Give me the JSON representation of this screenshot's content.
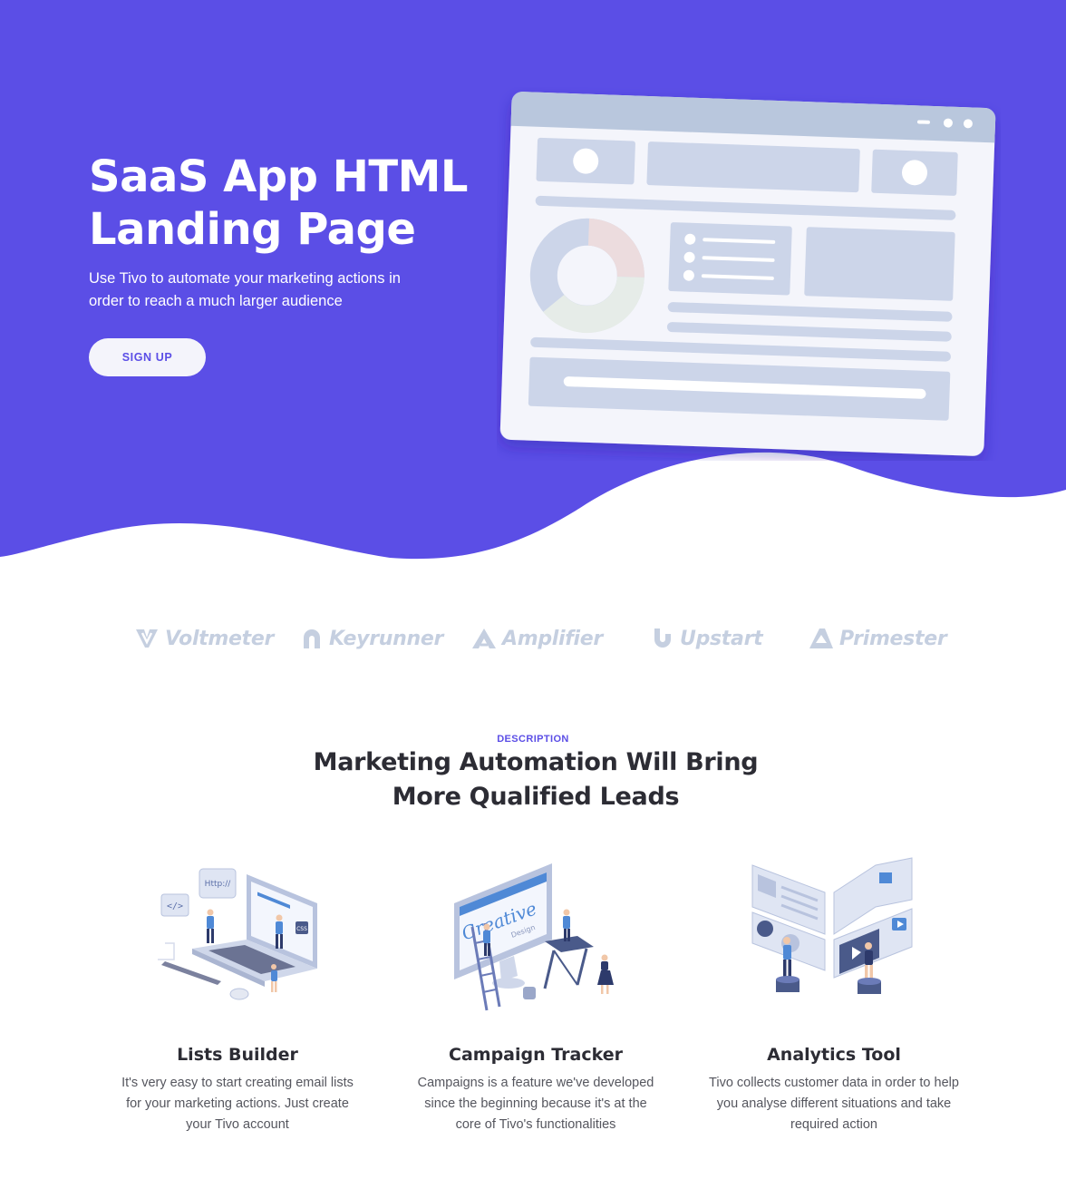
{
  "colors": {
    "brand": "#5b4ee6",
    "mockup_bg": "#f4f5fb",
    "mockup_block": "#ccd5e9",
    "logo": "#c5cfe0"
  },
  "hero": {
    "title": "SaaS App HTML Landing Page",
    "subtitle": "Use Tivo to automate your marketing actions in order to reach a much larger audience",
    "cta_label": "SIGN UP"
  },
  "logos": [
    {
      "name": "Voltmeter",
      "icon": "voltmeter-logo-icon"
    },
    {
      "name": "Keyrunner",
      "icon": "keyrunner-logo-icon"
    },
    {
      "name": "Amplifier",
      "icon": "amplifier-logo-icon"
    },
    {
      "name": "Upstart",
      "icon": "upstart-logo-icon"
    },
    {
      "name": "Primester",
      "icon": "primester-logo-icon"
    }
  ],
  "description": {
    "eyebrow": "DESCRIPTION",
    "title": "Marketing Automation Will Bring More Qualified Leads"
  },
  "features": [
    {
      "title": "Lists Builder",
      "text": "It's very easy to start creating email lists for your marketing actions. Just create your Tivo account",
      "illustration": "laptop-team-illustration",
      "labels": [
        "Http://",
        "</>",
        "CSS"
      ]
    },
    {
      "title": "Campaign Tracker",
      "text": "Campaigns is a feature we've developed since the beginning because it's at the core of Tivo's functionalities",
      "illustration": "creative-design-illustration",
      "labels": [
        "Creative",
        "Design"
      ]
    },
    {
      "title": "Analytics Tool",
      "text": "Tivo collects customer data in order to help you analyse different situations and take required action",
      "illustration": "analytics-dashboard-illustration"
    }
  ]
}
